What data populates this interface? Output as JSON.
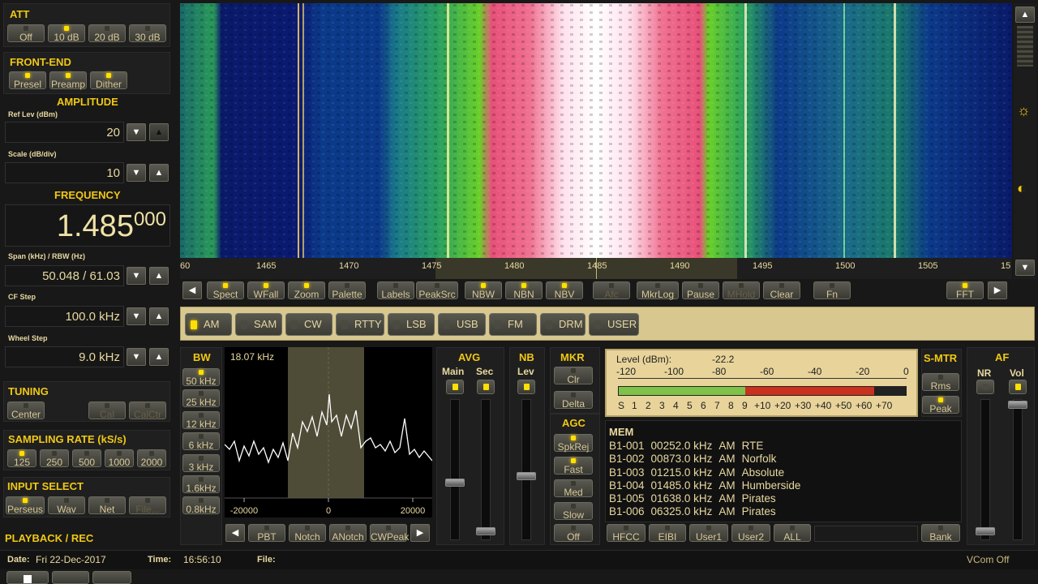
{
  "att": {
    "title": "ATT",
    "buttons": [
      {
        "label": "Off",
        "on": false
      },
      {
        "label": "10 dB",
        "on": true
      },
      {
        "label": "20 dB",
        "on": false
      },
      {
        "label": "30 dB",
        "on": false
      }
    ]
  },
  "frontend": {
    "title": "FRONT-END",
    "buttons": [
      {
        "label": "Presel",
        "on": true
      },
      {
        "label": "Preamp",
        "on": true
      },
      {
        "label": "Dither",
        "on": true
      }
    ]
  },
  "amplitude": {
    "title": "AMPLITUDE",
    "ref_label": "Ref Lev (dBm)",
    "ref_value": "20",
    "scale_label": "Scale (dB/div)",
    "scale_value": "10"
  },
  "frequency": {
    "title": "FREQUENCY",
    "main": "1.485",
    "fine": "000"
  },
  "span": {
    "label": "Span (kHz) / RBW (Hz)",
    "value": "50.048 / 61.03"
  },
  "cfstep": {
    "label": "CF Step",
    "value": "100.0 kHz"
  },
  "wheelstep": {
    "label": "Wheel Step",
    "value": "9.0 kHz"
  },
  "tuning": {
    "title": "TUNING",
    "buttons": [
      {
        "label": "Center"
      },
      {
        "label": "Cal"
      },
      {
        "label": "CalCtr"
      }
    ]
  },
  "sampling": {
    "title": "SAMPLING RATE (kS/s)",
    "buttons": [
      {
        "label": "125",
        "on": true
      },
      {
        "label": "250",
        "on": false
      },
      {
        "label": "500",
        "on": false
      },
      {
        "label": "1000",
        "on": false
      },
      {
        "label": "2000",
        "on": false
      }
    ]
  },
  "input": {
    "title": "INPUT SELECT",
    "buttons": [
      {
        "label": "Perseus",
        "on": true
      },
      {
        "label": "Wav",
        "on": false
      },
      {
        "label": "Net",
        "on": false
      },
      {
        "label": "File...",
        "on": false
      }
    ]
  },
  "playback": {
    "title": "PLAYBACK / REC"
  },
  "status": {
    "date_label": "Date:",
    "date": "Fri 22-Dec-2017",
    "time_label": "Time:",
    "time": "16:56:10",
    "file_label": "File:",
    "vcom": "VCom Off"
  },
  "freq_axis": {
    "labels": [
      "60",
      "1465",
      "1470",
      "1475",
      "1480",
      "1485",
      "1490",
      "1495",
      "1500",
      "1505",
      "15"
    ]
  },
  "toolbar": {
    "buttons": [
      "Spect",
      "WFall",
      "Zoom",
      "Palette",
      "Labels",
      "PeakSrc",
      "NBW",
      "NBN",
      "NBV",
      "Afc",
      "MkrLog",
      "Pause",
      "MHold",
      "Clear",
      "Fn",
      "FFT"
    ]
  },
  "modes": [
    {
      "label": "AM",
      "on": true
    },
    {
      "label": "SAM",
      "on": false
    },
    {
      "label": "CW",
      "on": false
    },
    {
      "label": "RTTY",
      "on": false
    },
    {
      "label": "LSB",
      "on": false
    },
    {
      "label": "USB",
      "on": false
    },
    {
      "label": "FM",
      "on": false
    },
    {
      "label": "DRM",
      "on": false
    },
    {
      "label": "USER",
      "on": false
    }
  ],
  "bw": {
    "title": "BW",
    "buttons": [
      {
        "label": "50 kHz",
        "on": true
      },
      {
        "label": "25 kHz",
        "on": false
      },
      {
        "label": "12 kHz",
        "on": false
      },
      {
        "label": "6 kHz",
        "on": false
      },
      {
        "label": "3 kHz",
        "on": false
      },
      {
        "label": "1.6kHz",
        "on": false
      },
      {
        "label": "0.8kHz",
        "on": false
      }
    ]
  },
  "filter": {
    "readout": "18.07 kHz",
    "ticks": [
      "-20000",
      "0",
      "20000"
    ],
    "buttons": [
      "PBT",
      "Notch",
      "ANotch",
      "CWPeak"
    ]
  },
  "avg": {
    "title": "AVG",
    "main": "Main",
    "sec": "Sec"
  },
  "nb": {
    "title": "NB",
    "lev": "Lev"
  },
  "mkr": {
    "title": "MKR",
    "buttons": [
      "Clr",
      "Delta"
    ]
  },
  "agc": {
    "title": "AGC",
    "buttons": [
      "SpkRej",
      "Fast",
      "Med",
      "Slow",
      "Off"
    ]
  },
  "meter": {
    "label": "Level (dBm):",
    "value": "-22.2",
    "level": 0.53,
    "scale_top": [
      "-120",
      "-100",
      "-80",
      "-60",
      "-40",
      "-20",
      "0"
    ],
    "scale_bottom": [
      "S",
      "1",
      "2",
      "3",
      "4",
      "5",
      "6",
      "7",
      "8",
      "9",
      "+10",
      "+20",
      "+30",
      "+40",
      "+50",
      "+60",
      "+70"
    ]
  },
  "smtr": {
    "title": "S-MTR",
    "buttons": [
      "Rms",
      "Peak"
    ]
  },
  "af": {
    "title": "AF",
    "nr": "NR",
    "vol": "Vol"
  },
  "mem": {
    "title": "MEM",
    "rows": [
      {
        "id": "B1-001",
        "freq": "00252.0 kHz",
        "mode": "AM",
        "name": "RTE"
      },
      {
        "id": "B1-002",
        "freq": "00873.0 kHz",
        "mode": "AM",
        "name": "Norfolk"
      },
      {
        "id": "B1-003",
        "freq": "01215.0 kHz",
        "mode": "AM",
        "name": "Absolute"
      },
      {
        "id": "B1-004",
        "freq": "01485.0 kHz",
        "mode": "AM",
        "name": "Humberside"
      },
      {
        "id": "B1-005",
        "freq": "01638.0 kHz",
        "mode": "AM",
        "name": "Pirates"
      },
      {
        "id": "B1-006",
        "freq": "06325.0 kHz",
        "mode": "AM",
        "name": "Pirates"
      }
    ],
    "buttons": [
      "HFCC",
      "EIBI",
      "User1",
      "User2",
      "ALL",
      "Bank"
    ]
  },
  "colors": {
    "accent": "#f0c814",
    "led_on": "#ffe000",
    "meter_bg": "#e8d49a",
    "meter_green": "#7fc24a",
    "meter_red": "#c8321e"
  }
}
